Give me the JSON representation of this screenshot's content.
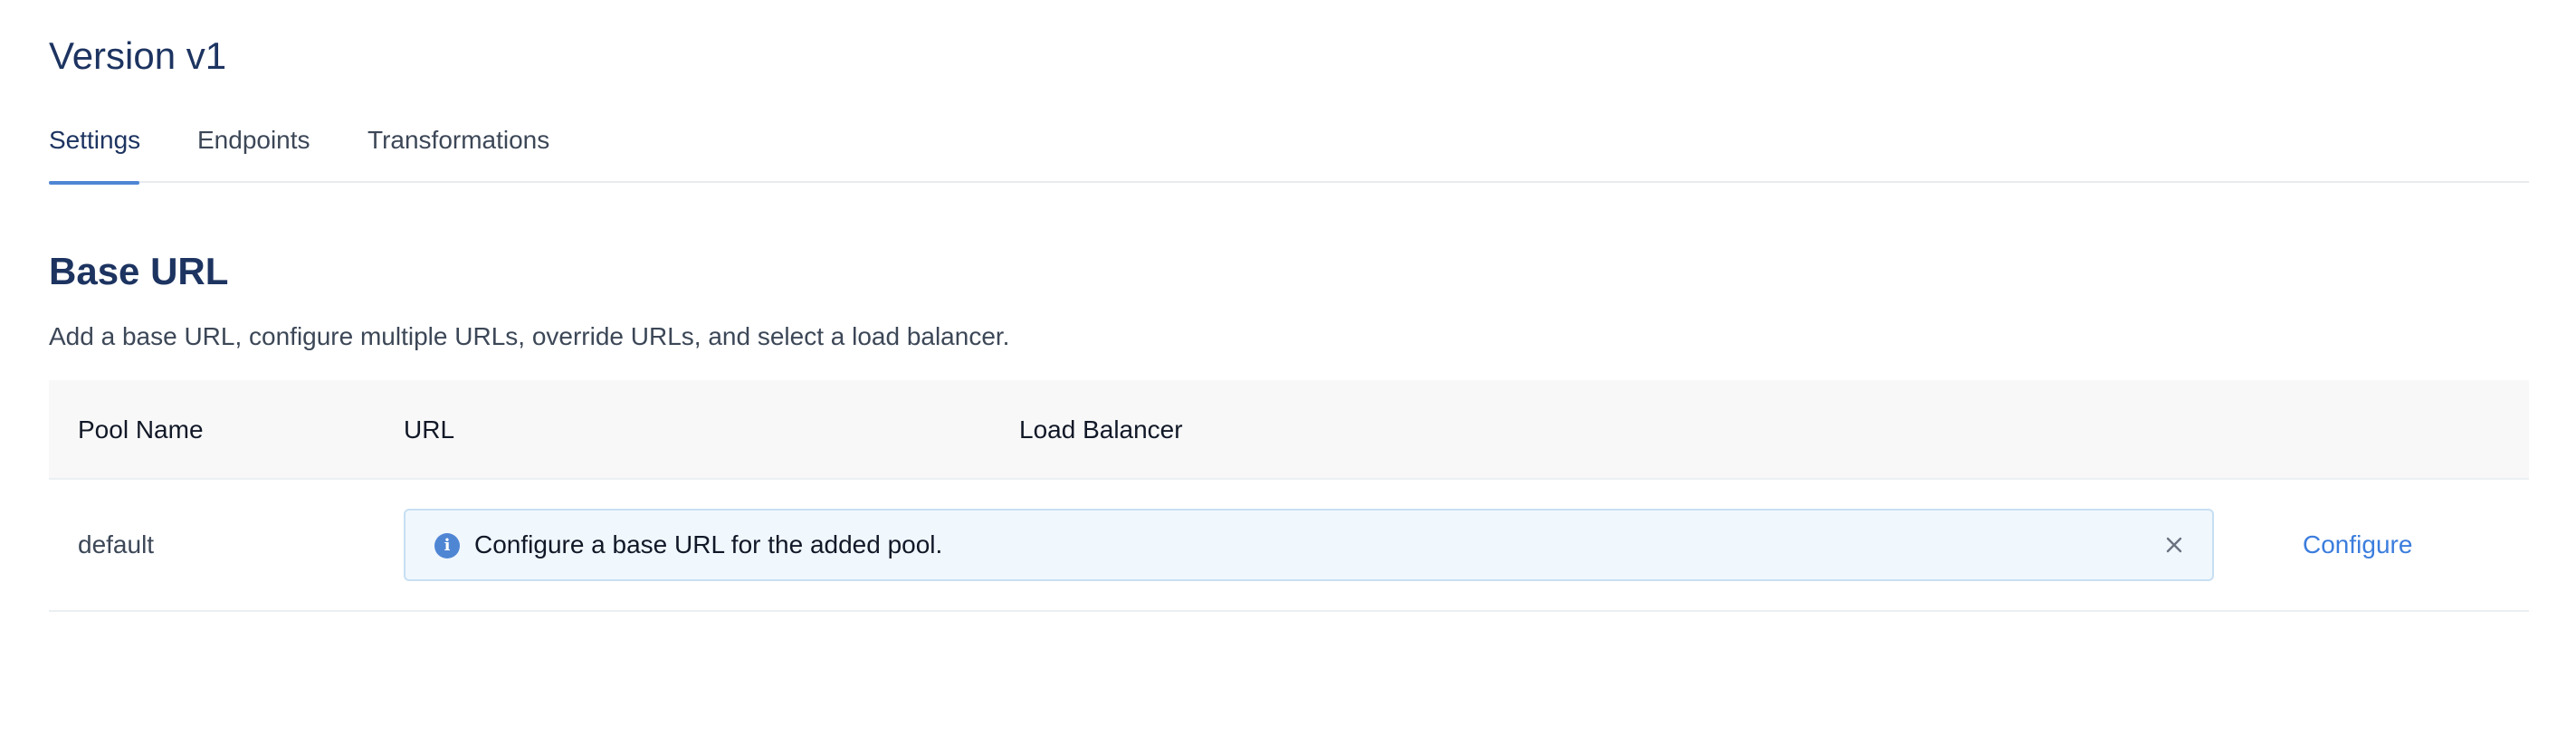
{
  "header": {
    "title": "Version v1"
  },
  "tabs": [
    {
      "label": "Settings",
      "active": true
    },
    {
      "label": "Endpoints",
      "active": false
    },
    {
      "label": "Transformations",
      "active": false
    }
  ],
  "base_url": {
    "title": "Base URL",
    "description": "Add a base URL, configure multiple URLs, override URLs, and select a load balancer.",
    "table": {
      "columns": [
        "Pool Name",
        "URL",
        "Load Balancer"
      ],
      "rows": [
        {
          "pool_name": "default",
          "notice": "Configure a base URL for the added pool.",
          "action": "Configure"
        }
      ]
    }
  },
  "icons": {
    "notice_icon": "info-icon",
    "dismiss_icon": "close-icon"
  },
  "colors": {
    "accent": "#4f86d4",
    "link": "#3b7ddd",
    "heading": "#1d3461",
    "notice_bg": "#f0f7fd"
  }
}
